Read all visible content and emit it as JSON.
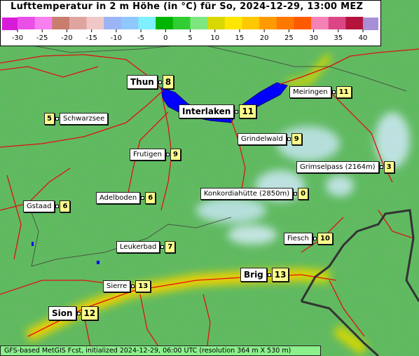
{
  "title": "Lufttemperatur in 2 m Höhe (in °C) für So, 2024-12-29, 13:00 MEZ",
  "footer": "GFS-based MetGIS Fcst, initialized 2024-12-29, 06:00 UTC  (resolution 364 m X 530 m)",
  "legend": {
    "ticks": [
      "-30",
      "-25",
      "-20",
      "-15",
      "-10",
      "-5",
      "0",
      "5",
      "10",
      "15",
      "20",
      "25",
      "30",
      "35",
      "40"
    ],
    "colors": [
      "#d91ad9",
      "#ea4fe8",
      "#f77ff0",
      "#c87d6e",
      "#e0a4a0",
      "#f0c8c8",
      "#9ab4f5",
      "#8fc7ff",
      "#7ef0ff",
      "#00b400",
      "#32cd32",
      "#7ee67e",
      "#d8d800",
      "#ffe600",
      "#ffc800",
      "#ff9b00",
      "#ff7800",
      "#ff5a00",
      "#f582b4",
      "#dc4686",
      "#b4143c",
      "#a98ed8"
    ]
  },
  "locations": [
    {
      "name": "Thun",
      "value": "8",
      "big": true
    },
    {
      "name": "Interlaken",
      "value": "11",
      "big": true
    },
    {
      "name": "Meiringen",
      "value": "11"
    },
    {
      "name": "Schwarzsee",
      "value": "5",
      "prefix": true
    },
    {
      "name": "Grindelwald",
      "value": "9"
    },
    {
      "name": "Frutigen",
      "value": "9"
    },
    {
      "name": "Grimselpass (2164m)",
      "value": "3"
    },
    {
      "name": "Konkordiahütte (2850m)",
      "value": "0"
    },
    {
      "name": "Adelboden",
      "value": "6"
    },
    {
      "name": "Gstaad",
      "value": "6"
    },
    {
      "name": "Fiesch",
      "value": "10"
    },
    {
      "name": "Leukerbad",
      "value": "7"
    },
    {
      "name": "Brig",
      "value": "13",
      "big": true
    },
    {
      "name": "Sierre",
      "value": "13"
    },
    {
      "name": "Sion",
      "value": "12",
      "big": true
    }
  ]
}
